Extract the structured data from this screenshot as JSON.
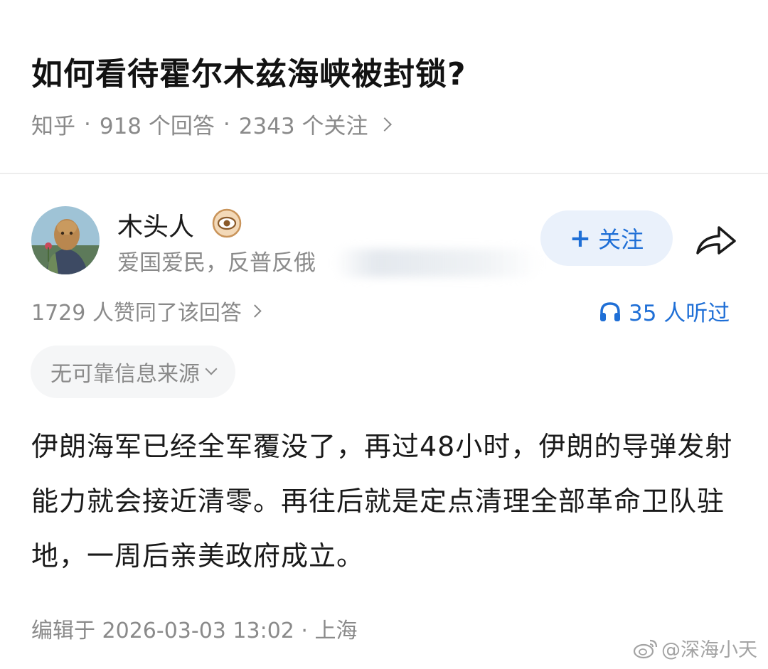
{
  "question": {
    "title": "如何看待霍尔木兹海峡被封锁?",
    "source": "知乎",
    "answers": "918 个回答",
    "followers": "2343 个关注"
  },
  "author": {
    "name": "木头人",
    "bio": "爱国爱民，反普反俄",
    "follow_label": "关注"
  },
  "stats": {
    "likes_text": "1729 人赞同了该回答",
    "listen_text": "35 人听过"
  },
  "tag": {
    "label": "无可靠信息来源"
  },
  "answer": {
    "text": "伊朗海军已经全军覆没了，再过48小时，伊朗的导弹发射能力就会接近清零。再往后就是定点清理全部革命卫队驻地，一周后亲美政府成立。"
  },
  "footer": {
    "edit_info": "编辑于 2026-03-03 13:02 · 上海",
    "watermark": "@深海小天"
  },
  "colors": {
    "accent": "#1f6fd6",
    "muted": "#8a8a8a",
    "follow_bg": "#eaf1fb",
    "tag_bg": "#f5f6f7"
  },
  "icons": [
    "badge-icon",
    "plus-icon",
    "share-icon",
    "headphones-icon",
    "chevron-right-icon",
    "chevron-down-icon",
    "weibo-icon"
  ]
}
